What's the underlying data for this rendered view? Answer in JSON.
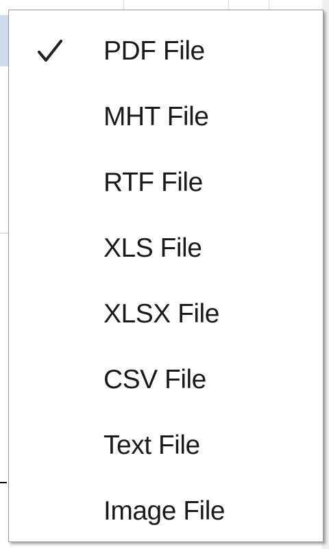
{
  "menu": {
    "items": [
      {
        "label": "PDF File",
        "checked": true
      },
      {
        "label": "MHT File",
        "checked": false
      },
      {
        "label": "RTF File",
        "checked": false
      },
      {
        "label": "XLS File",
        "checked": false
      },
      {
        "label": "XLSX File",
        "checked": false
      },
      {
        "label": "CSV File",
        "checked": false
      },
      {
        "label": "Text File",
        "checked": false
      },
      {
        "label": "Image File",
        "checked": false
      }
    ],
    "check_icon": "checkmark-icon"
  },
  "colors": {
    "menu_background": "#ffffff",
    "menu_border": "#979797",
    "text": "#1a1a1a"
  }
}
